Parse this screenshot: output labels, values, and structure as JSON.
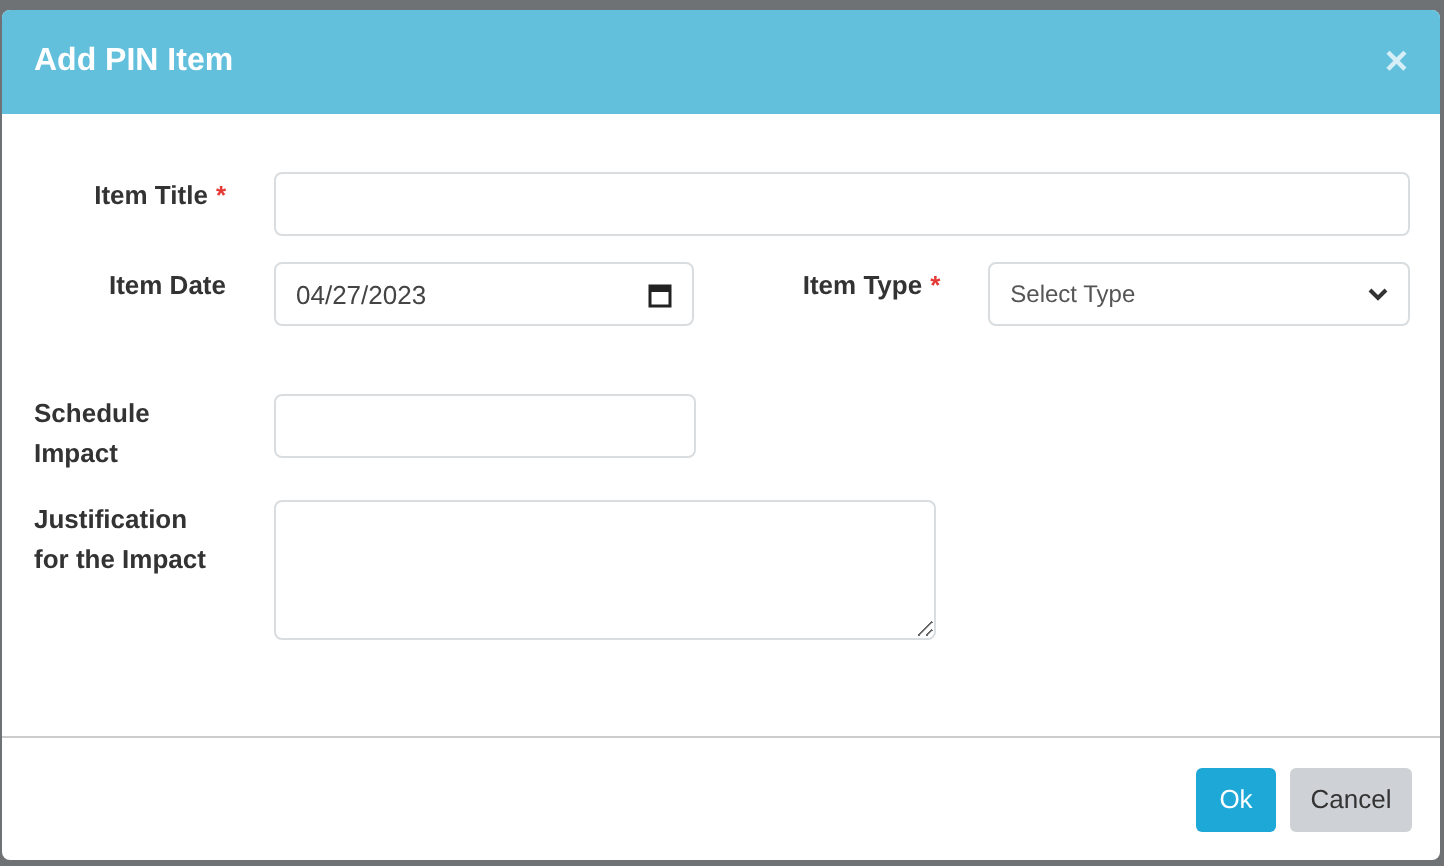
{
  "dialog": {
    "title": "Add PIN Item",
    "close": "×"
  },
  "fields": {
    "item_title": {
      "label": "Item Title",
      "required_mark": "*"
    },
    "item_date": {
      "label": "Item Date",
      "value": "04/27/2023"
    },
    "item_type": {
      "label": "Item Type",
      "required_mark": "*",
      "placeholder": "Select Type"
    },
    "schedule_impact": {
      "label": "Schedule Impact"
    },
    "justification": {
      "label": "Justification for the Impact"
    }
  },
  "buttons": [
    {
      "label": "Ok",
      "kind": "primary"
    },
    {
      "label": "Cancel",
      "kind": "secondary"
    }
  ]
}
